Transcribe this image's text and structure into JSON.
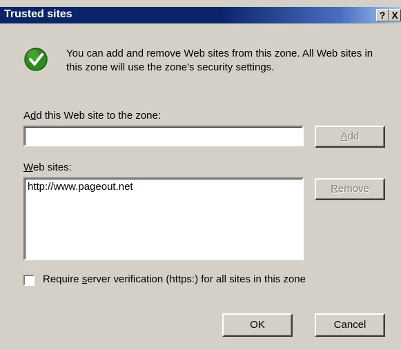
{
  "window": {
    "title": "Trusted sites",
    "help_button": "?",
    "close_button": "X"
  },
  "info": {
    "icon": "green-check-icon",
    "text": "You can add and remove Web sites from this zone. All Web sites in this zone will use the zone's security settings."
  },
  "add_section": {
    "label_accel": "d",
    "label_pre": "A",
    "label_post": "d this Web site to the zone:",
    "input_value": "",
    "add_button_accel": "A",
    "add_button_rest": "dd"
  },
  "sites_section": {
    "label_accel": "W",
    "label_rest": "eb sites:",
    "items": [
      "http://www.pageout.net"
    ],
    "remove_button_accel": "R",
    "remove_button_rest": "emove"
  },
  "verification": {
    "checked": false,
    "label_pre": "Require ",
    "label_accel": "s",
    "label_post": "erver verification (https:) for all sites in this zone"
  },
  "buttons": {
    "ok": "OK",
    "cancel": "Cancel"
  },
  "colors": {
    "titlebar": "#0a246a",
    "dialog_bg": "#d4d0c8",
    "check_icon": "#2e8b1e"
  }
}
